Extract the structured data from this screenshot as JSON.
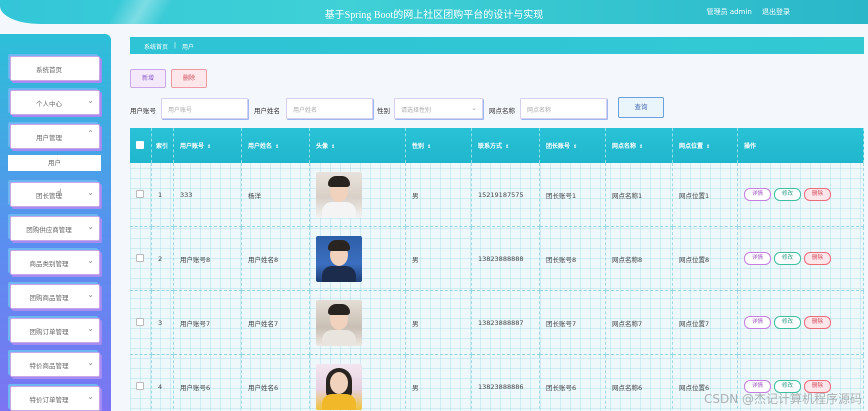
{
  "header": {
    "title": "基于Spring Boot的网上社区团购平台的设计与实现",
    "user": "管理员 admin",
    "logout": "退出登录"
  },
  "sidebar": {
    "items": [
      {
        "label": "系统首页",
        "chevron": false
      },
      {
        "label": "个人中心",
        "chevron": true
      },
      {
        "label": "用户管理",
        "chevron": true,
        "expanded": true
      },
      {
        "label": "团长管理",
        "chevron": true
      },
      {
        "label": "团购供应商管理",
        "chevron": true
      },
      {
        "label": "商品类别管理",
        "chevron": true
      },
      {
        "label": "团购商品管理",
        "chevron": true
      },
      {
        "label": "团购订单管理",
        "chevron": true
      },
      {
        "label": "特价商品管理",
        "chevron": true
      },
      {
        "label": "特价订单管理",
        "chevron": true
      }
    ],
    "sub_item": "用户"
  },
  "breadcrumb": {
    "home": "系统首页",
    "sep": "|",
    "current": "用户"
  },
  "toolbar": {
    "add": "新增",
    "delete": "删除"
  },
  "search": {
    "account_label": "用户账号",
    "account_ph": "用户账号",
    "name_label": "用户姓名",
    "name_ph": "用户姓名",
    "gender_label": "性别",
    "gender_ph": "请选择性别",
    "site_label": "网点名称",
    "site_ph": "网点名称",
    "query": "查询"
  },
  "table": {
    "headers": [
      "索引",
      "用户账号",
      "用户姓名",
      "头像",
      "性别",
      "联系方式",
      "团长账号",
      "网点名称",
      "网点位置",
      "操作"
    ],
    "actions": {
      "detail": "详情",
      "edit": "修改",
      "delete": "删除"
    },
    "rows": [
      {
        "idx": "1",
        "account": "333",
        "name": "杨洋",
        "gender": "男",
        "phone": "15219187575",
        "leader": "团长账号1",
        "site": "网点名称1",
        "loc": "网点位置1"
      },
      {
        "idx": "2",
        "account": "用户账号8",
        "name": "用户姓名8",
        "gender": "男",
        "phone": "13823888888",
        "leader": "团长账号8",
        "site": "网点名称8",
        "loc": "网点位置8"
      },
      {
        "idx": "3",
        "account": "用户账号7",
        "name": "用户姓名7",
        "gender": "男",
        "phone": "13823888887",
        "leader": "团长账号7",
        "site": "网点名称7",
        "loc": "网点位置7"
      },
      {
        "idx": "4",
        "account": "用户账号6",
        "name": "用户姓名6",
        "gender": "男",
        "phone": "13823888886",
        "leader": "团长账号6",
        "site": "网点名称6",
        "loc": "网点位置6"
      }
    ]
  },
  "watermark": "CSDN @杰记计算机程序源码"
}
